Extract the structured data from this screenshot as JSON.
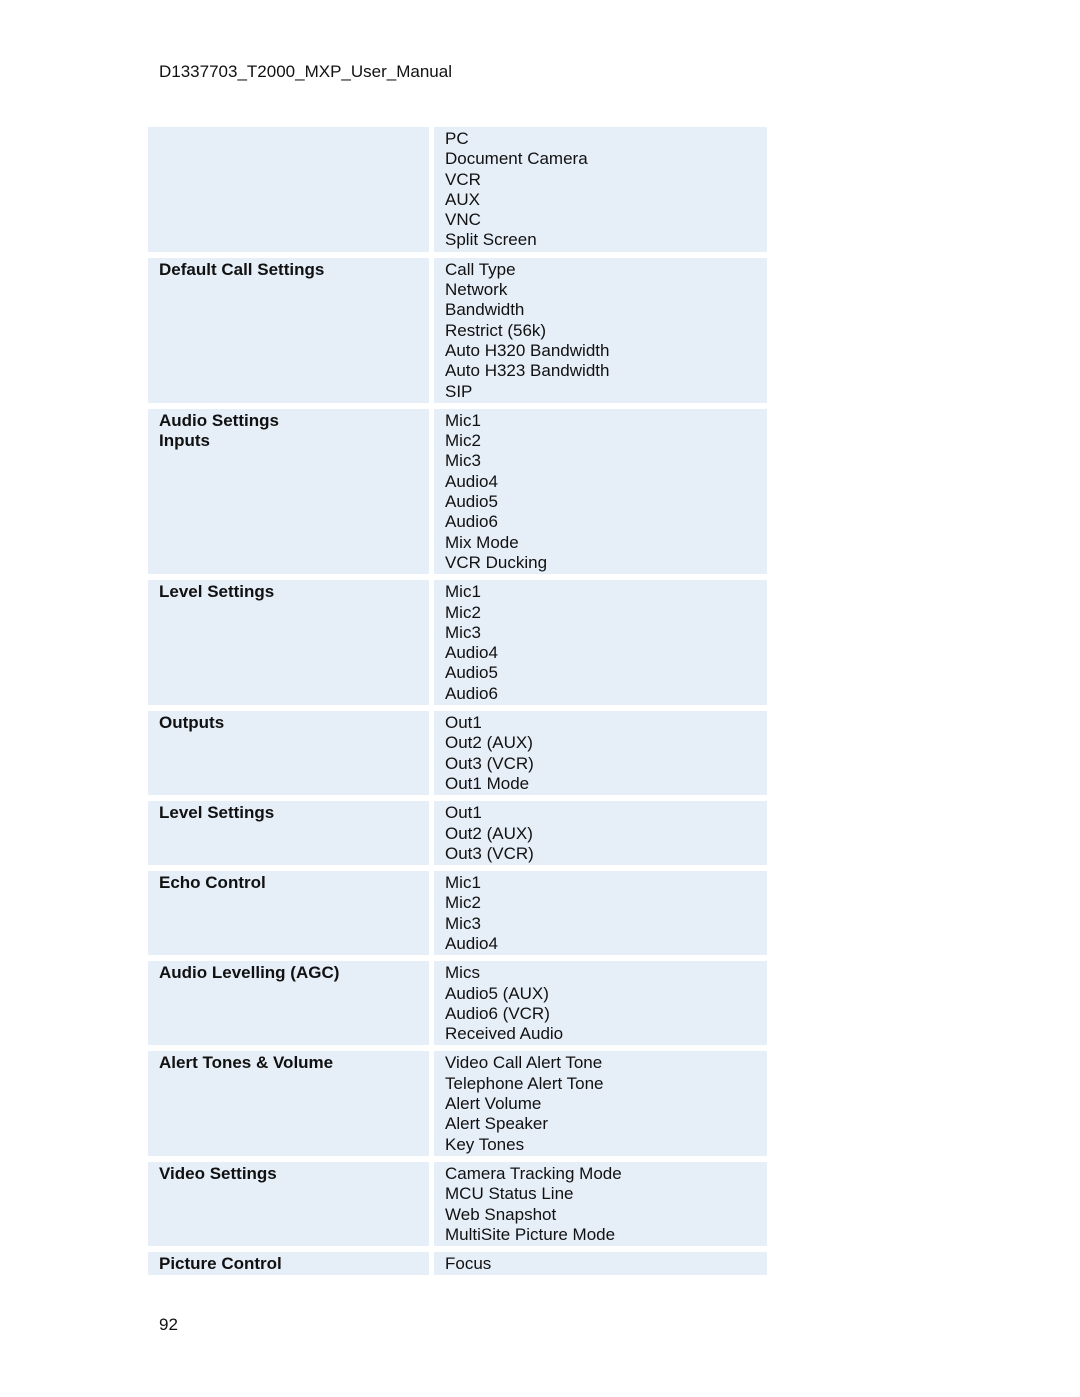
{
  "header": {
    "title": "D1337703_T2000_MXP_User_Manual"
  },
  "table": {
    "rows": [
      {
        "labels": [],
        "items": [
          "PC",
          "Document Camera",
          "VCR",
          "AUX",
          "VNC",
          "Split Screen"
        ]
      },
      {
        "labels": [
          "Default Call Settings"
        ],
        "items": [
          "Call Type",
          "Network",
          "Bandwidth",
          "Restrict (56k)",
          "Auto H320 Bandwidth",
          "Auto H323 Bandwidth",
          "SIP"
        ]
      },
      {
        "labels": [
          "Audio Settings",
          "Inputs"
        ],
        "items": [
          "Mic1",
          "Mic2",
          "Mic3",
          "Audio4",
          "Audio5",
          "Audio6",
          "Mix Mode",
          "VCR Ducking"
        ]
      },
      {
        "labels": [
          "Level Settings"
        ],
        "items": [
          "Mic1",
          "Mic2",
          "Mic3",
          "Audio4",
          "Audio5",
          "Audio6"
        ]
      },
      {
        "labels": [
          "Outputs"
        ],
        "items": [
          "Out1",
          "Out2 (AUX)",
          "Out3 (VCR)",
          "Out1 Mode"
        ]
      },
      {
        "labels": [
          "Level Settings"
        ],
        "items": [
          "Out1",
          "Out2 (AUX)",
          "Out3 (VCR)"
        ]
      },
      {
        "labels": [
          "Echo Control"
        ],
        "items": [
          "Mic1",
          "Mic2",
          "Mic3",
          "Audio4"
        ]
      },
      {
        "labels": [
          "Audio Levelling (AGC)"
        ],
        "items": [
          "Mics",
          "Audio5 (AUX)",
          "Audio6 (VCR)",
          "Received Audio"
        ]
      },
      {
        "labels": [
          "Alert Tones & Volume"
        ],
        "items": [
          "Video Call Alert Tone",
          "Telephone Alert Tone",
          "Alert Volume",
          "Alert Speaker",
          "Key Tones"
        ]
      },
      {
        "labels": [
          "Video Settings"
        ],
        "items": [
          "Camera Tracking Mode",
          "MCU Status Line",
          "Web Snapshot",
          "MultiSite Picture Mode"
        ]
      },
      {
        "labels": [
          "Picture Control"
        ],
        "items": [
          "Focus"
        ]
      }
    ]
  },
  "footer": {
    "page_number": "92"
  },
  "colors": {
    "cell_background": "#e6eef8",
    "text": "#111111"
  }
}
